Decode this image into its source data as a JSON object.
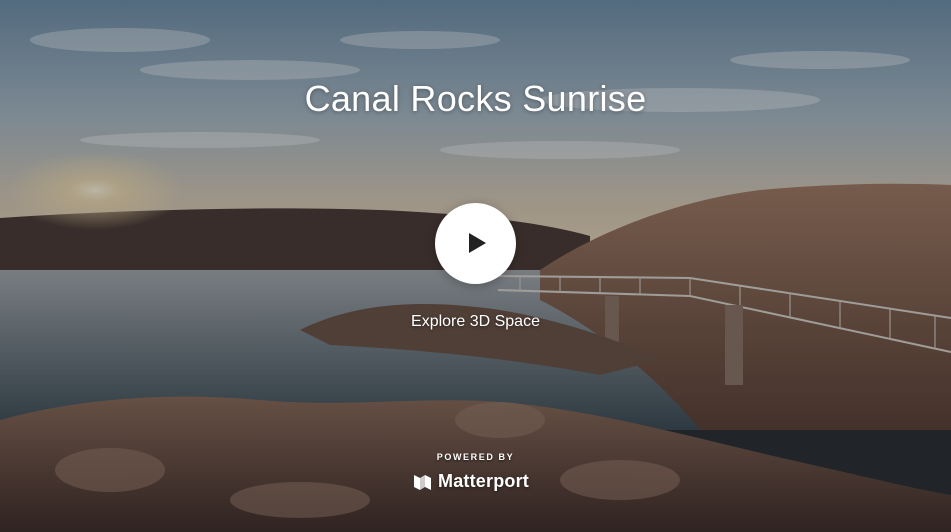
{
  "space": {
    "title": "Canal Rocks Sunrise"
  },
  "player": {
    "play_icon": "play-icon",
    "explore_label": "Explore 3D Space"
  },
  "branding": {
    "powered_by": "POWERED BY",
    "name": "Matterport",
    "logo_icon": "matterport-logo-icon"
  },
  "colors": {
    "play_button_bg": "#ffffff",
    "play_icon": "#222222",
    "text": "#ffffff"
  }
}
